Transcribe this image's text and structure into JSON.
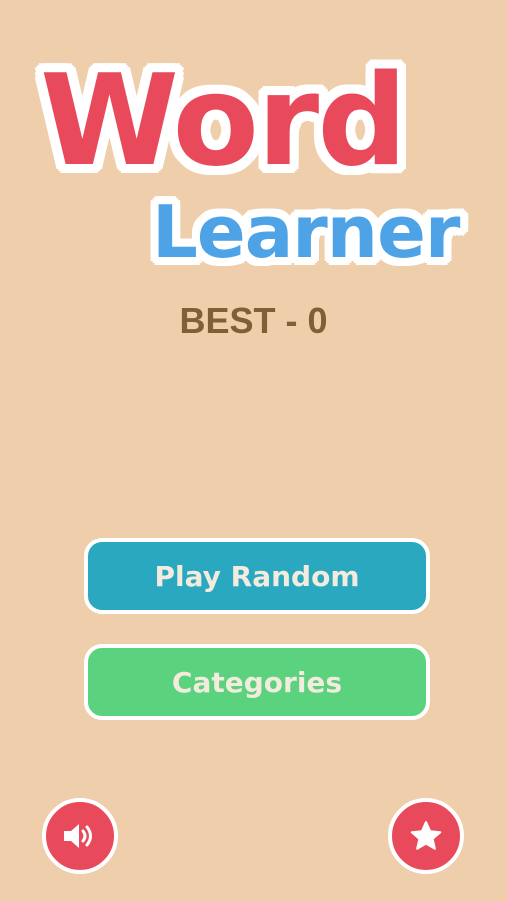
{
  "title": {
    "line1": "Word",
    "line2": "Learner"
  },
  "best_score": "BEST - 0",
  "buttons": {
    "play_random": "Play Random",
    "categories": "Categories"
  },
  "icons": {
    "sound": "speaker-icon",
    "rate": "star-icon"
  },
  "colors": {
    "background": "#EECEAB",
    "title_red": "#E84A5C",
    "title_blue": "#4DA3E6",
    "best_text": "#7F5F36",
    "play_button": "#2AA8BF",
    "categories_button": "#5BD27D",
    "round_button": "#E84A5C"
  }
}
